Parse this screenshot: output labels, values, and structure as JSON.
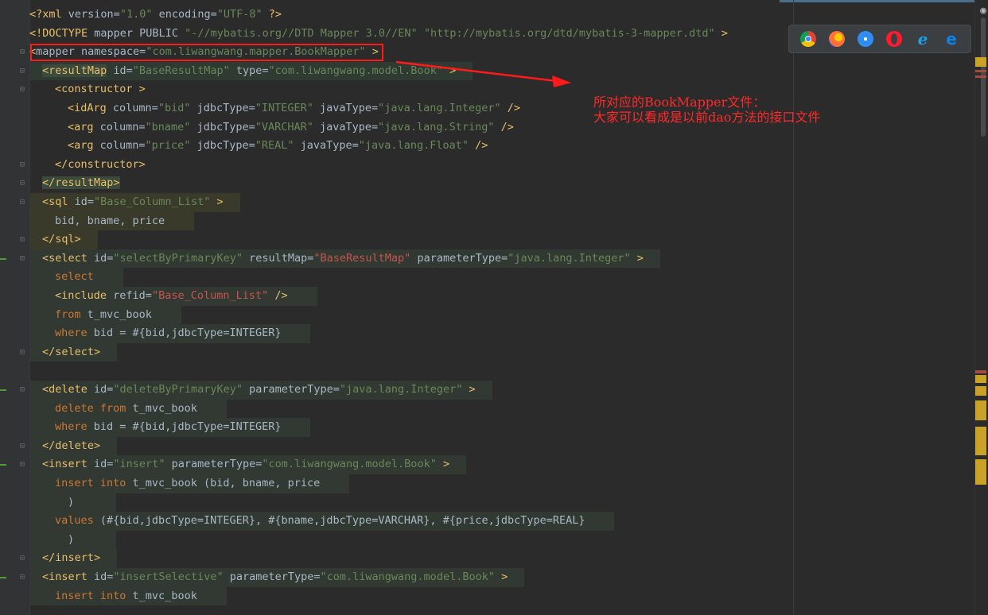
{
  "colors": {
    "background": "#2b2b2b",
    "gutter": "#313335",
    "tag": "#e8bf6a",
    "attr_value": "#6a8759",
    "keyword": "#cc7832",
    "text": "#a9b7c6",
    "annotation": "#ff2a2a"
  },
  "browser_icons": [
    "chrome-icon",
    "firefox-icon",
    "safari-icon",
    "opera-icon",
    "ie-icon",
    "edge-icon"
  ],
  "annotation": {
    "line1": "所对应的BookMapper文件：",
    "line2": "大家可以看成是以前dao方法的接口文件"
  },
  "code_lines": [
    {
      "hl": "",
      "indent": 37,
      "tokens": [
        [
          "t-tag",
          "<?xml "
        ],
        [
          "t-def",
          "version="
        ],
        [
          "t-val",
          "\"1.0\""
        ],
        [
          "t-def",
          " encoding="
        ],
        [
          "t-val",
          "\"UTF-8\""
        ],
        [
          "t-tag",
          " ?>"
        ]
      ]
    },
    {
      "hl": "",
      "indent": 37,
      "tokens": [
        [
          "t-tag",
          "<!DOCTYPE "
        ],
        [
          "t-def",
          "mapper PUBLIC "
        ],
        [
          "t-val",
          "\"-//mybatis.org//DTD Mapper 3.0//EN\""
        ],
        [
          "t-def",
          " "
        ],
        [
          "t-val",
          "\"http://mybatis.org/dtd/mybatis-3-mapper.dtd\""
        ],
        [
          "t-tag",
          " >"
        ]
      ]
    },
    {
      "hl": "",
      "indent": 37,
      "tokens": [
        [
          "t-tag",
          "<"
        ],
        [
          "t-def",
          "mapper namespace="
        ],
        [
          "t-val",
          "\"com.liwangwang.mapper.BookMapper\""
        ],
        [
          "t-tag",
          " >"
        ]
      ]
    },
    {
      "hl": "hl-sel",
      "indent": 53,
      "tokens": [
        [
          "t-tagbg",
          "<resultMap"
        ],
        [
          "t-def",
          " id="
        ],
        [
          "t-val",
          "\"BaseResultMap\""
        ],
        [
          "t-def",
          " type="
        ],
        [
          "t-val",
          "\"com.liwangwang.model.Book\""
        ],
        [
          "t-tag",
          " >"
        ]
      ]
    },
    {
      "hl": "",
      "indent": 69,
      "tokens": [
        [
          "t-tag",
          "<constructor "
        ],
        [
          "t-tag",
          ">"
        ]
      ]
    },
    {
      "hl": "",
      "indent": 85,
      "tokens": [
        [
          "t-tag",
          "<idArg "
        ],
        [
          "t-def",
          "column="
        ],
        [
          "t-val",
          "\"bid\""
        ],
        [
          "t-def",
          " jdbcType="
        ],
        [
          "t-val",
          "\"INTEGER\""
        ],
        [
          "t-def",
          " javaType="
        ],
        [
          "t-val",
          "\"java.lang.Integer\""
        ],
        [
          "t-tag",
          " />"
        ]
      ]
    },
    {
      "hl": "",
      "indent": 85,
      "tokens": [
        [
          "t-tag",
          "<arg "
        ],
        [
          "t-def",
          "column="
        ],
        [
          "t-val",
          "\"bname\""
        ],
        [
          "t-def",
          " jdbcType="
        ],
        [
          "t-val",
          "\"VARCHAR\""
        ],
        [
          "t-def",
          " javaType="
        ],
        [
          "t-val",
          "\"java.lang.String\""
        ],
        [
          "t-tag",
          " />"
        ]
      ]
    },
    {
      "hl": "",
      "indent": 85,
      "tokens": [
        [
          "t-tag",
          "<arg "
        ],
        [
          "t-def",
          "column="
        ],
        [
          "t-val",
          "\"price\""
        ],
        [
          "t-def",
          " jdbcType="
        ],
        [
          "t-val",
          "\"REAL\""
        ],
        [
          "t-def",
          " javaType="
        ],
        [
          "t-val",
          "\"java.lang.Float\""
        ],
        [
          "t-tag",
          " />"
        ]
      ]
    },
    {
      "hl": "",
      "indent": 69,
      "tokens": [
        [
          "t-tag",
          "</constructor>"
        ]
      ]
    },
    {
      "hl": "",
      "indent": 53,
      "tokens": [
        [
          "t-tagbg",
          "</resultMap>"
        ]
      ]
    },
    {
      "hl": "hl-y",
      "indent": 53,
      "tokens": [
        [
          "t-tag",
          "<sql "
        ],
        [
          "t-def",
          "id="
        ],
        [
          "t-val",
          "\"Base_Column_List\""
        ],
        [
          "t-tag",
          " >"
        ]
      ]
    },
    {
      "hl": "hl-y",
      "indent": 69,
      "tokens": [
        [
          "t-plain",
          "bid, bname, price"
        ]
      ]
    },
    {
      "hl": "hl-y",
      "indent": 53,
      "tokens": [
        [
          "t-tag",
          "</sql>"
        ]
      ]
    },
    {
      "hl": "hl-g",
      "indent": 53,
      "tokens": [
        [
          "t-tag",
          "<select "
        ],
        [
          "t-def",
          "id="
        ],
        [
          "t-val",
          "\"selectByPrimaryKey\""
        ],
        [
          "t-def",
          " resultMap="
        ],
        [
          "t-val2",
          "\"BaseResultMap\""
        ],
        [
          "t-def",
          " parameterType="
        ],
        [
          "t-val",
          "\"java.lang.Integer\""
        ],
        [
          "t-tag",
          " >"
        ]
      ]
    },
    {
      "hl": "hl-g",
      "indent": 69,
      "tokens": [
        [
          "t-kw",
          "select"
        ]
      ]
    },
    {
      "hl": "hl-g",
      "indent": 69,
      "tokens": [
        [
          "t-tag",
          "<include "
        ],
        [
          "t-def",
          "refid="
        ],
        [
          "t-val2",
          "\"Base_Column_List\""
        ],
        [
          "t-tag",
          " />"
        ]
      ]
    },
    {
      "hl": "hl-g",
      "indent": 69,
      "tokens": [
        [
          "t-kw",
          "from "
        ],
        [
          "t-plain",
          "t_mvc_book"
        ]
      ]
    },
    {
      "hl": "hl-g",
      "indent": 69,
      "tokens": [
        [
          "t-kw",
          "where "
        ],
        [
          "t-plain",
          "bid = #{bid,jdbcType=INTEGER}"
        ]
      ]
    },
    {
      "hl": "hl-g",
      "indent": 53,
      "tokens": [
        [
          "t-tag",
          "</select>"
        ]
      ]
    },
    {
      "hl": "",
      "indent": 53,
      "tokens": []
    },
    {
      "hl": "hl-g",
      "indent": 53,
      "tokens": [
        [
          "t-tag",
          "<delete "
        ],
        [
          "t-def",
          "id="
        ],
        [
          "t-val",
          "\"deleteByPrimaryKey\""
        ],
        [
          "t-def",
          " parameterType="
        ],
        [
          "t-val",
          "\"java.lang.Integer\""
        ],
        [
          "t-tag",
          " >"
        ]
      ]
    },
    {
      "hl": "hl-g",
      "indent": 69,
      "tokens": [
        [
          "t-kw",
          "delete from "
        ],
        [
          "t-plain",
          "t_mvc_book"
        ]
      ]
    },
    {
      "hl": "hl-g",
      "indent": 69,
      "tokens": [
        [
          "t-kw",
          "where "
        ],
        [
          "t-plain",
          "bid = #{bid,jdbcType=INTEGER}"
        ]
      ]
    },
    {
      "hl": "hl-g",
      "indent": 53,
      "tokens": [
        [
          "t-tag",
          "</delete>"
        ]
      ]
    },
    {
      "hl": "hl-g",
      "indent": 53,
      "tokens": [
        [
          "t-tag",
          "<insert "
        ],
        [
          "t-def",
          "id="
        ],
        [
          "t-val",
          "\"insert\""
        ],
        [
          "t-def",
          " parameterType="
        ],
        [
          "t-val",
          "\"com.liwangwang.model.Book\""
        ],
        [
          "t-tag",
          " >"
        ]
      ]
    },
    {
      "hl": "hl-g",
      "indent": 69,
      "tokens": [
        [
          "t-kw",
          "insert into "
        ],
        [
          "t-plain",
          "t_mvc_book (bid, bname, price"
        ]
      ]
    },
    {
      "hl": "hl-g",
      "indent": 85,
      "tokens": [
        [
          "t-plain",
          ")"
        ]
      ]
    },
    {
      "hl": "hl-g",
      "indent": 69,
      "tokens": [
        [
          "t-kw",
          "values "
        ],
        [
          "t-plain",
          "(#{bid,jdbcType=INTEGER}, #{bname,jdbcType=VARCHAR}, #{price,jdbcType=REAL}"
        ]
      ]
    },
    {
      "hl": "hl-g",
      "indent": 85,
      "tokens": [
        [
          "t-plain",
          ")"
        ]
      ]
    },
    {
      "hl": "hl-g",
      "indent": 53,
      "tokens": [
        [
          "t-tag",
          "</insert>"
        ]
      ]
    },
    {
      "hl": "hl-g",
      "indent": 53,
      "tokens": [
        [
          "t-tag",
          "<insert "
        ],
        [
          "t-def",
          "id="
        ],
        [
          "t-val",
          "\"insertSelective\""
        ],
        [
          "t-def",
          " parameterType="
        ],
        [
          "t-val",
          "\"com.liwangwang.model.Book\""
        ],
        [
          "t-tag",
          " >"
        ]
      ]
    },
    {
      "hl": "hl-g",
      "indent": 69,
      "tokens": [
        [
          "t-kw",
          "insert into "
        ],
        [
          "t-plain",
          "t_mvc_book"
        ]
      ]
    }
  ]
}
